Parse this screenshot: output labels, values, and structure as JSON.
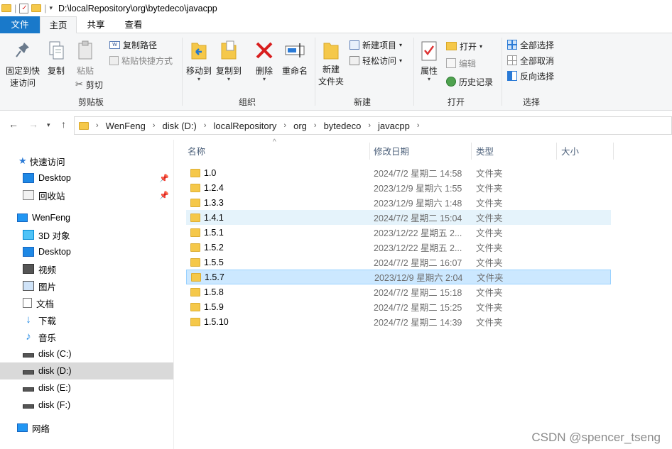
{
  "titlebar": {
    "path": "D:\\localRepository\\org\\bytedeco\\javacpp"
  },
  "tabs": {
    "file": "文件",
    "home": "主页",
    "share": "共享",
    "view": "查看"
  },
  "ribbon": {
    "clipboard": {
      "pin": "固定到快\n速访问",
      "copy": "复制",
      "paste": "粘贴",
      "copy_path": "复制路径",
      "paste_shortcut": "粘贴快捷方式",
      "cut": "剪切",
      "label": "剪贴板"
    },
    "organize": {
      "move_to": "移动到",
      "copy_to": "复制到",
      "delete": "删除",
      "rename": "重命名",
      "label": "组织"
    },
    "new": {
      "new_folder": "新建\n文件夹",
      "new_item": "新建项目",
      "easy_access": "轻松访问",
      "label": "新建"
    },
    "open": {
      "properties": "属性",
      "open": "打开",
      "edit": "编辑",
      "history": "历史记录",
      "label": "打开"
    },
    "select": {
      "select_all": "全部选择",
      "select_none": "全部取消",
      "invert": "反向选择",
      "label": "选择"
    }
  },
  "address": {
    "crumbs": [
      "WenFeng",
      "disk (D:)",
      "localRepository",
      "org",
      "bytedeco",
      "javacpp"
    ]
  },
  "nav": {
    "quick_access": "快速访问",
    "desktop_pinned": "Desktop",
    "recycle": "回收站",
    "wenfeng": "WenFeng",
    "objects3d": "3D 对象",
    "desktop": "Desktop",
    "videos": "视频",
    "pictures": "图片",
    "documents": "文档",
    "downloads": "下载",
    "music": "音乐",
    "disk_c": "disk (C:)",
    "disk_d": "disk (D:)",
    "disk_e": "disk (E:)",
    "disk_f": "disk (F:)",
    "network": "网络"
  },
  "columns": {
    "name": "名称",
    "date": "修改日期",
    "type": "类型",
    "size": "大小"
  },
  "files": [
    {
      "name": "1.0",
      "date": "2024/7/2 星期二 14:58",
      "type": "文件夹"
    },
    {
      "name": "1.2.4",
      "date": "2023/12/9 星期六 1:55",
      "type": "文件夹"
    },
    {
      "name": "1.3.3",
      "date": "2023/12/9 星期六 1:48",
      "type": "文件夹"
    },
    {
      "name": "1.4.1",
      "date": "2024/7/2 星期二 15:04",
      "type": "文件夹"
    },
    {
      "name": "1.5.1",
      "date": "2023/12/22 星期五 2...",
      "type": "文件夹"
    },
    {
      "name": "1.5.2",
      "date": "2023/12/22 星期五 2...",
      "type": "文件夹"
    },
    {
      "name": "1.5.5",
      "date": "2024/7/2 星期二 16:07",
      "type": "文件夹"
    },
    {
      "name": "1.5.7",
      "date": "2023/12/9 星期六 2:04",
      "type": "文件夹"
    },
    {
      "name": "1.5.8",
      "date": "2024/7/2 星期二 15:18",
      "type": "文件夹"
    },
    {
      "name": "1.5.9",
      "date": "2024/7/2 星期二 15:25",
      "type": "文件夹"
    },
    {
      "name": "1.5.10",
      "date": "2024/7/2 星期二 14:39",
      "type": "文件夹"
    }
  ],
  "watermark": "CSDN @spencer_tseng"
}
